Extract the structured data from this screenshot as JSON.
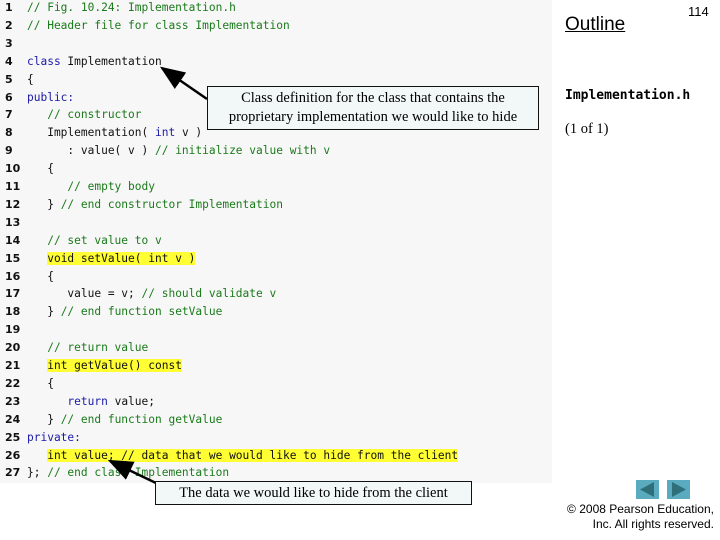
{
  "slide": {
    "outline_label": "Outline",
    "page_number": "114",
    "file_name": "Implementation.h",
    "page_of": "(1 of 1)",
    "copyright_line1": "© 2008 Pearson Education,",
    "copyright_line2": "Inc.  All rights reserved.",
    "nav": {
      "prev_icon": "triangle-left-icon",
      "next_icon": "triangle-right-icon"
    }
  },
  "callouts": [
    {
      "text_line1": "Class definition for the class that contains the",
      "text_line2": "proprietary implementation we would like to hide"
    },
    {
      "text": "The data we would like to hide from the client"
    }
  ],
  "code": {
    "lines": [
      {
        "n": "1",
        "segments": [
          {
            "t": "// Fig. 10.24: Implementation.h",
            "c": "cm"
          }
        ]
      },
      {
        "n": "2",
        "segments": [
          {
            "t": "// Header file for class Implementation",
            "c": "cm"
          }
        ]
      },
      {
        "n": "3",
        "segments": []
      },
      {
        "n": "4",
        "segments": [
          {
            "t": "class",
            "c": "kw"
          },
          {
            "t": " Implementation",
            "c": ""
          }
        ]
      },
      {
        "n": "5",
        "segments": [
          {
            "t": "{",
            "c": ""
          }
        ]
      },
      {
        "n": "6",
        "segments": [
          {
            "t": "public:",
            "c": "kw"
          }
        ]
      },
      {
        "n": "7",
        "segments": [
          {
            "t": "   // constructor",
            "c": "cm"
          }
        ]
      },
      {
        "n": "8",
        "segments": [
          {
            "t": "   Implementation( ",
            "c": ""
          },
          {
            "t": "int",
            "c": "kw"
          },
          {
            "t": " v )",
            "c": ""
          }
        ]
      },
      {
        "n": "9",
        "segments": [
          {
            "t": "      : value( v ) ",
            "c": ""
          },
          {
            "t": "// initialize value with v",
            "c": "cm"
          }
        ]
      },
      {
        "n": "10",
        "segments": [
          {
            "t": "   {",
            "c": ""
          }
        ]
      },
      {
        "n": "11",
        "segments": [
          {
            "t": "      // empty body",
            "c": "cm"
          }
        ]
      },
      {
        "n": "12",
        "segments": [
          {
            "t": "   } ",
            "c": ""
          },
          {
            "t": "// end constructor Implementation",
            "c": "cm"
          }
        ]
      },
      {
        "n": "13",
        "segments": []
      },
      {
        "n": "14",
        "segments": [
          {
            "t": "   // set value to v",
            "c": "cm"
          }
        ]
      },
      {
        "n": "15",
        "segments": [
          {
            "t": "   ",
            "c": ""
          },
          {
            "t": "void setValue( int v )",
            "c": "hl"
          }
        ]
      },
      {
        "n": "16",
        "segments": [
          {
            "t": "   {",
            "c": ""
          }
        ]
      },
      {
        "n": "17",
        "segments": [
          {
            "t": "      value = v; ",
            "c": ""
          },
          {
            "t": "// should validate v",
            "c": "cm"
          }
        ]
      },
      {
        "n": "18",
        "segments": [
          {
            "t": "   } ",
            "c": ""
          },
          {
            "t": "// end function setValue",
            "c": "cm"
          }
        ]
      },
      {
        "n": "19",
        "segments": []
      },
      {
        "n": "20",
        "segments": [
          {
            "t": "   // return value",
            "c": "cm"
          }
        ]
      },
      {
        "n": "21",
        "segments": [
          {
            "t": "   ",
            "c": ""
          },
          {
            "t": "int getValue() const",
            "c": "hl"
          }
        ]
      },
      {
        "n": "22",
        "segments": [
          {
            "t": "   {",
            "c": ""
          }
        ]
      },
      {
        "n": "23",
        "segments": [
          {
            "t": "      ",
            "c": ""
          },
          {
            "t": "return",
            "c": "kw"
          },
          {
            "t": " value;",
            "c": ""
          }
        ]
      },
      {
        "n": "24",
        "segments": [
          {
            "t": "   } ",
            "c": ""
          },
          {
            "t": "// end function getValue",
            "c": "cm"
          }
        ]
      },
      {
        "n": "25",
        "segments": [
          {
            "t": "private:",
            "c": "kw"
          }
        ]
      },
      {
        "n": "26",
        "segments": [
          {
            "t": "   ",
            "c": ""
          },
          {
            "t": "int value; // data that we would like to hide from the client",
            "c": "hl"
          }
        ]
      },
      {
        "n": "27",
        "segments": [
          {
            "t": "}; ",
            "c": ""
          },
          {
            "t": "// end class Implementation",
            "c": "cm"
          }
        ]
      }
    ]
  }
}
